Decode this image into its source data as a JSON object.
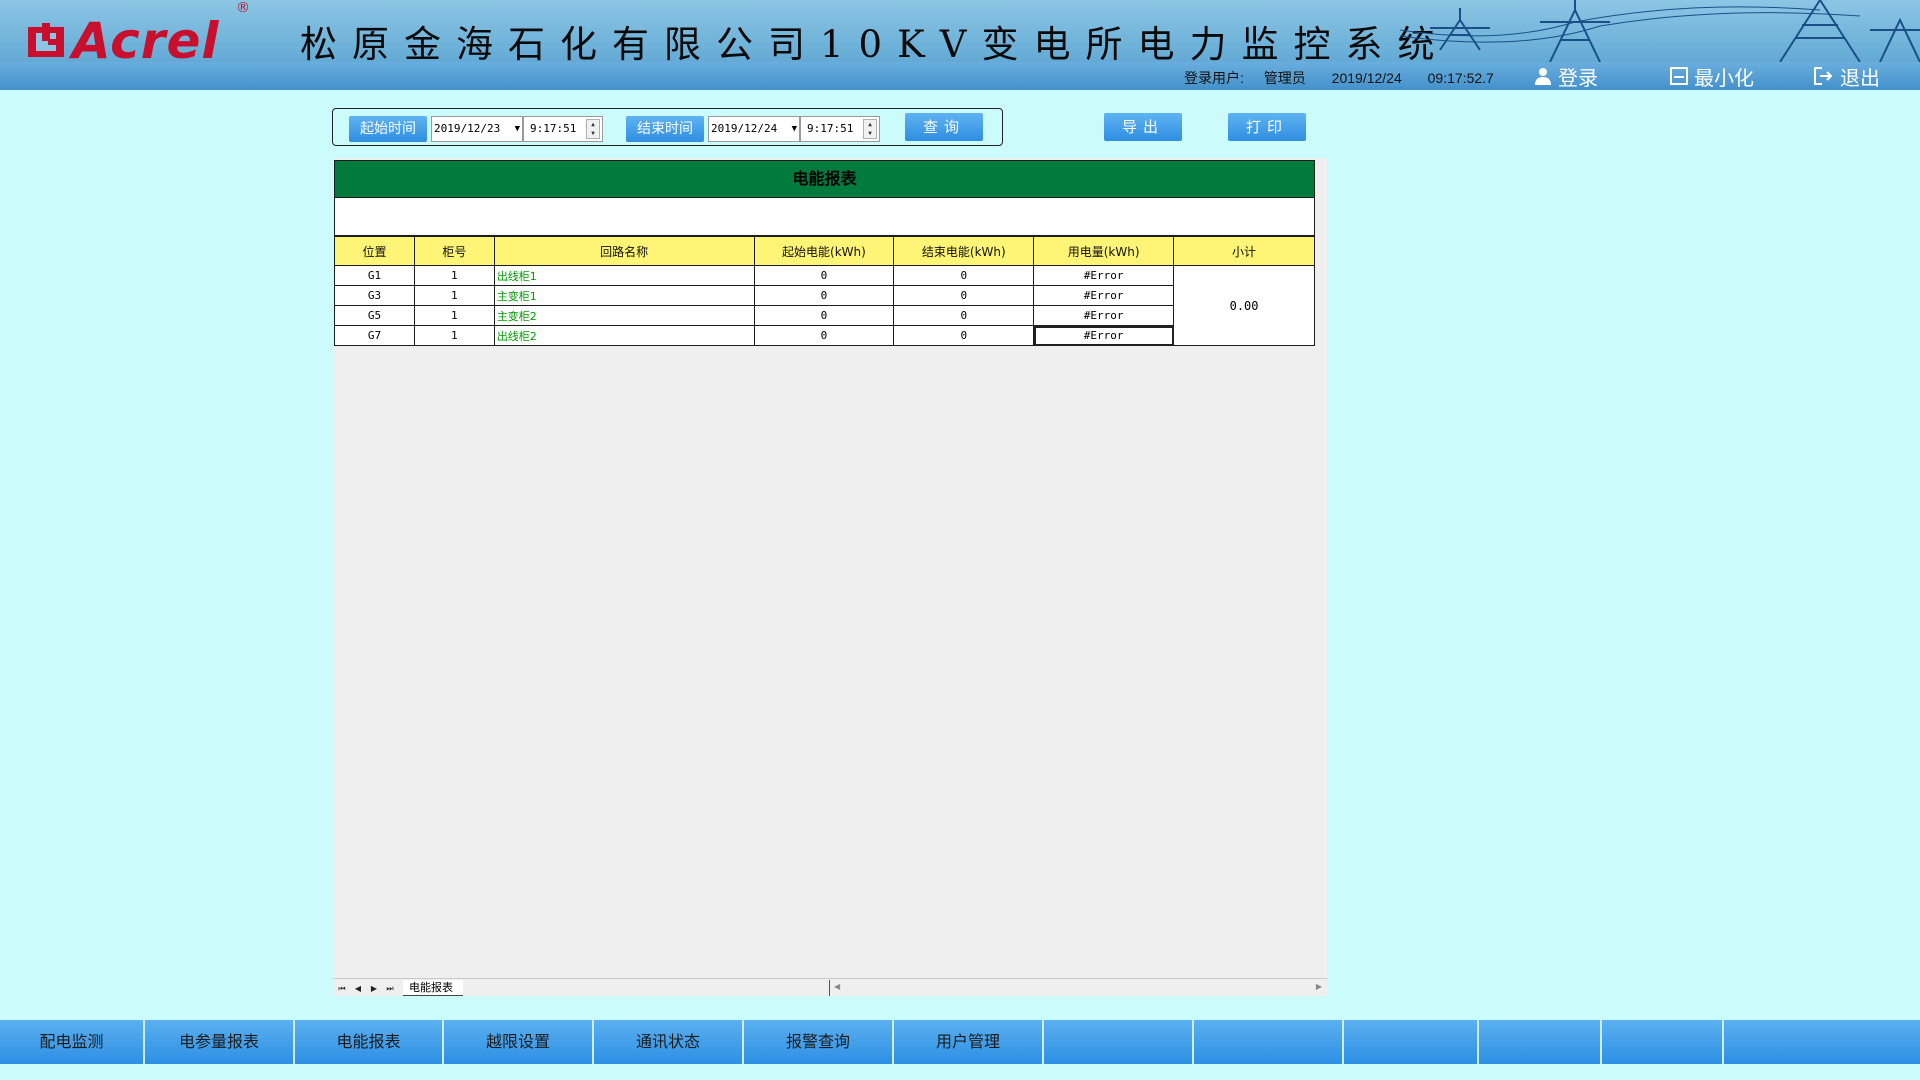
{
  "header": {
    "logo_text": "Acrel",
    "logo_reg": "®",
    "system_title": "松原金海石化有限公司10KV变电所电力监控系统",
    "login_user_label": "登录用户:",
    "login_user": "管理员",
    "date": "2019/12/24",
    "time": "09:17:52.7",
    "login_btn": "登录",
    "minimize_btn": "最小化",
    "exit_btn": "退出"
  },
  "query": {
    "start_label": "起始时间",
    "start_date": "2019/12/23",
    "start_time": "9:17:51",
    "end_label": "结束时间",
    "end_date": "2019/12/24",
    "end_time": "9:17:51",
    "query_btn": "查询",
    "export_btn": "导出",
    "print_btn": "打印"
  },
  "report": {
    "title": "电能报表",
    "columns": [
      "位置",
      "柜号",
      "回路名称",
      "起始电能(kWh)",
      "结束电能(kWh)",
      "用电量(kWh)",
      "小计"
    ],
    "rows": [
      {
        "pos": "G1",
        "cab": "1",
        "name": "出线柜1",
        "start": "0",
        "end": "0",
        "usage": "#Error"
      },
      {
        "pos": "G3",
        "cab": "1",
        "name": "主变柜1",
        "start": "0",
        "end": "0",
        "usage": "#Error"
      },
      {
        "pos": "G5",
        "cab": "1",
        "name": "主变柜2",
        "start": "0",
        "end": "0",
        "usage": "#Error"
      },
      {
        "pos": "G7",
        "cab": "1",
        "name": "出线柜2",
        "start": "0",
        "end": "0",
        "usage": "#Error"
      }
    ],
    "subtotal": "0.00",
    "sheet_tab": "电能报表"
  },
  "nav": [
    "配电监测",
    "电参量报表",
    "电能报表",
    "越限设置",
    "通讯状态",
    "报警查询",
    "用户管理",
    "",
    "",
    "",
    "",
    "",
    ""
  ],
  "colors": {
    "title_green": "#007a3d",
    "header_yellow": "#fef475",
    "button_blue": "#2f8ee0",
    "page_bg": "#ccfbfb"
  }
}
